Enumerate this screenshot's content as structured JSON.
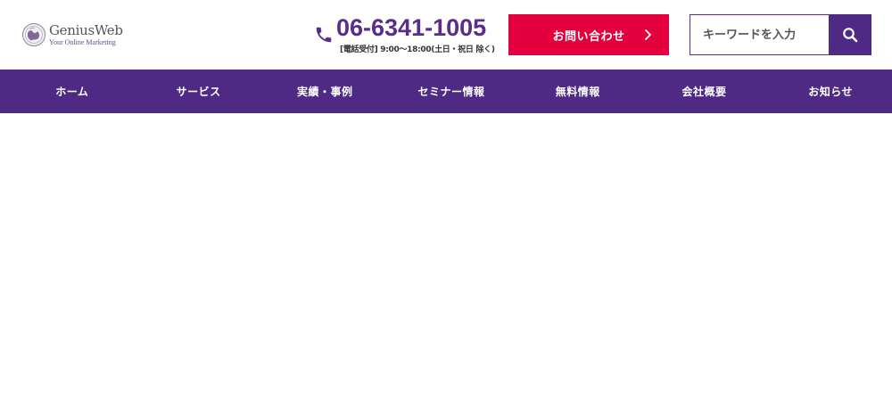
{
  "brand": {
    "name": "GeniusWeb",
    "tagline": "Your Online Marketing",
    "accent_color": "#4e2a84",
    "cta_color": "#e4003f"
  },
  "phone": {
    "icon": "phone-icon",
    "number": "06-6341-1005",
    "hours": "[電話受付] 9:00～18:00(土日・祝日 除く)"
  },
  "contact": {
    "label": "お問い合わせ",
    "icon": "chevron-right-icon"
  },
  "search": {
    "placeholder": "キーワードを入力",
    "value": "",
    "icon": "search-icon"
  },
  "nav": {
    "items": [
      {
        "label": "ホーム"
      },
      {
        "label": "サービス"
      },
      {
        "label": "実績・事例"
      },
      {
        "label": "セミナー情報"
      },
      {
        "label": "無料情報"
      },
      {
        "label": "会社概要"
      },
      {
        "label": "お知らせ"
      }
    ]
  }
}
